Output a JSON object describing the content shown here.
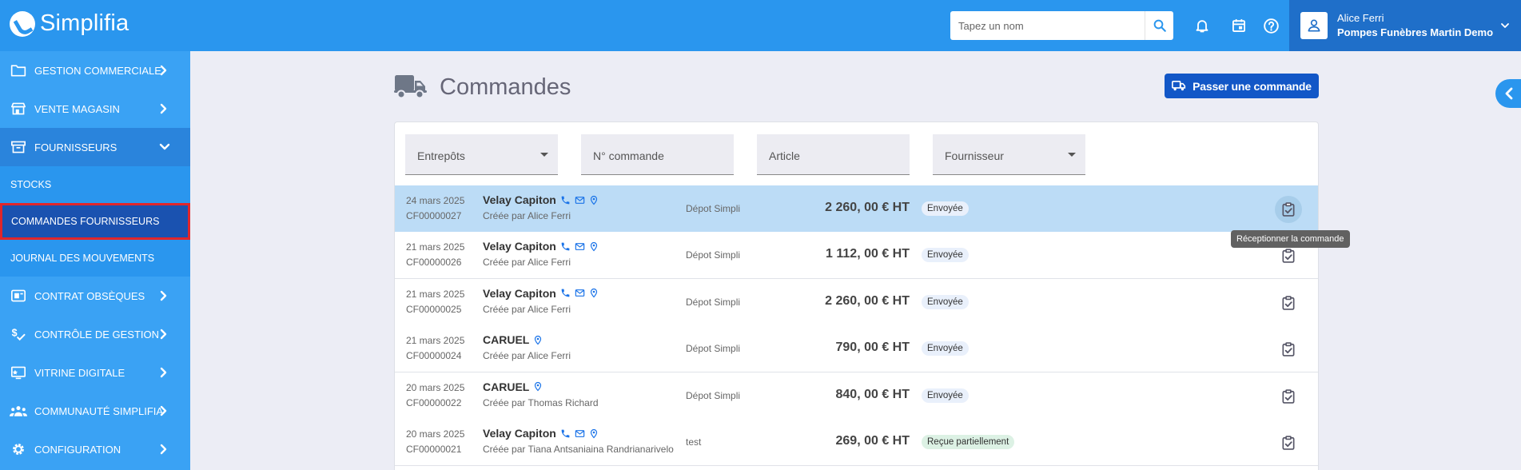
{
  "app": {
    "name": "Simplifia"
  },
  "search": {
    "placeholder": "Tapez un nom"
  },
  "header_icons": [
    "bell-icon",
    "calendar-icon",
    "help-icon"
  ],
  "user": {
    "name": "Alice Ferri",
    "company": "Pompes Funèbres Martin Demo"
  },
  "sidebar": {
    "items": [
      {
        "label": "GESTION COMMERCIALE",
        "icon": "folder-icon"
      },
      {
        "label": "VENTE MAGASIN",
        "icon": "store-icon"
      },
      {
        "label": "FOURNISSEURS",
        "icon": "archive-icon",
        "expanded": true,
        "subitems": [
          {
            "label": "STOCKS"
          },
          {
            "label": "COMMANDES FOURNISSEURS",
            "selected": true
          },
          {
            "label": "JOURNAL DES MOUVEMENTS"
          }
        ]
      },
      {
        "label": "CONTRAT OBSÈQUES",
        "icon": "contract-icon"
      },
      {
        "label": "CONTRÔLE DE GESTION",
        "icon": "dollar-check-icon"
      },
      {
        "label": "VITRINE DIGITALE",
        "icon": "showcase-icon"
      },
      {
        "label": "COMMUNAUTÉ SIMPLIFIA",
        "icon": "community-icon"
      },
      {
        "label": "CONFIGURATION",
        "icon": "gear-icon"
      }
    ]
  },
  "page": {
    "title": "Commandes",
    "order_button": "Passer une commande"
  },
  "filters": [
    {
      "label": "Entrepôts",
      "type": "select"
    },
    {
      "label": "N° commande",
      "type": "text"
    },
    {
      "label": "Article",
      "type": "text"
    },
    {
      "label": "Fournisseur",
      "type": "select"
    }
  ],
  "orders": [
    {
      "date": "24 mars 2025",
      "ref": "CF00000027",
      "supplier": "Velay Capiton",
      "contacts": [
        "phone",
        "mail",
        "location"
      ],
      "creator": "Créée par Alice Ferri",
      "depot": "Dépot Simpli",
      "amount": "2 260, 00  €  HT",
      "status": "Envoyée"
    },
    {
      "date": "21 mars 2025",
      "ref": "CF00000026",
      "supplier": "Velay Capiton",
      "contacts": [
        "phone",
        "mail",
        "location"
      ],
      "creator": "Créée par Alice Ferri",
      "depot": "Dépot Simpli",
      "amount": "1 112, 00  €  HT",
      "status": "Envoyée"
    },
    {
      "date": "21 mars 2025",
      "ref": "CF00000025",
      "supplier": "Velay Capiton",
      "contacts": [
        "phone",
        "mail",
        "location"
      ],
      "creator": "Créée par Alice Ferri",
      "depot": "Dépot Simpli",
      "amount": "2 260, 00  €  HT",
      "status": "Envoyée"
    },
    {
      "date": "21 mars 2025",
      "ref": "CF00000024",
      "supplier": "CARUEL",
      "contacts": [
        "location"
      ],
      "creator": "Créée par Alice Ferri",
      "depot": "Dépot Simpli",
      "amount": "790, 00  €  HT",
      "status": "Envoyée"
    },
    {
      "date": "20 mars 2025",
      "ref": "CF00000022",
      "supplier": "CARUEL",
      "contacts": [
        "location"
      ],
      "creator": "Créée par Thomas Richard",
      "depot": "Dépot Simpli",
      "amount": "840, 00  €  HT",
      "status": "Envoyée"
    },
    {
      "date": "20 mars 2025",
      "ref": "CF00000021",
      "supplier": "Velay Capiton",
      "contacts": [
        "phone",
        "mail",
        "location"
      ],
      "creator": "Créée par Tiana Antsaniaina Randrianarivelo",
      "depot": "test",
      "amount": "269, 00  €  HT",
      "status": "Reçue partiellement"
    }
  ],
  "tooltip": "Réceptionner la commande",
  "colors": {
    "topbar": "#2a96ee",
    "sidebar": "#3aa2f4",
    "primary_button": "#1257c7",
    "selected_row": "#bcdcf6",
    "contact_icon": "#1a73e8"
  }
}
